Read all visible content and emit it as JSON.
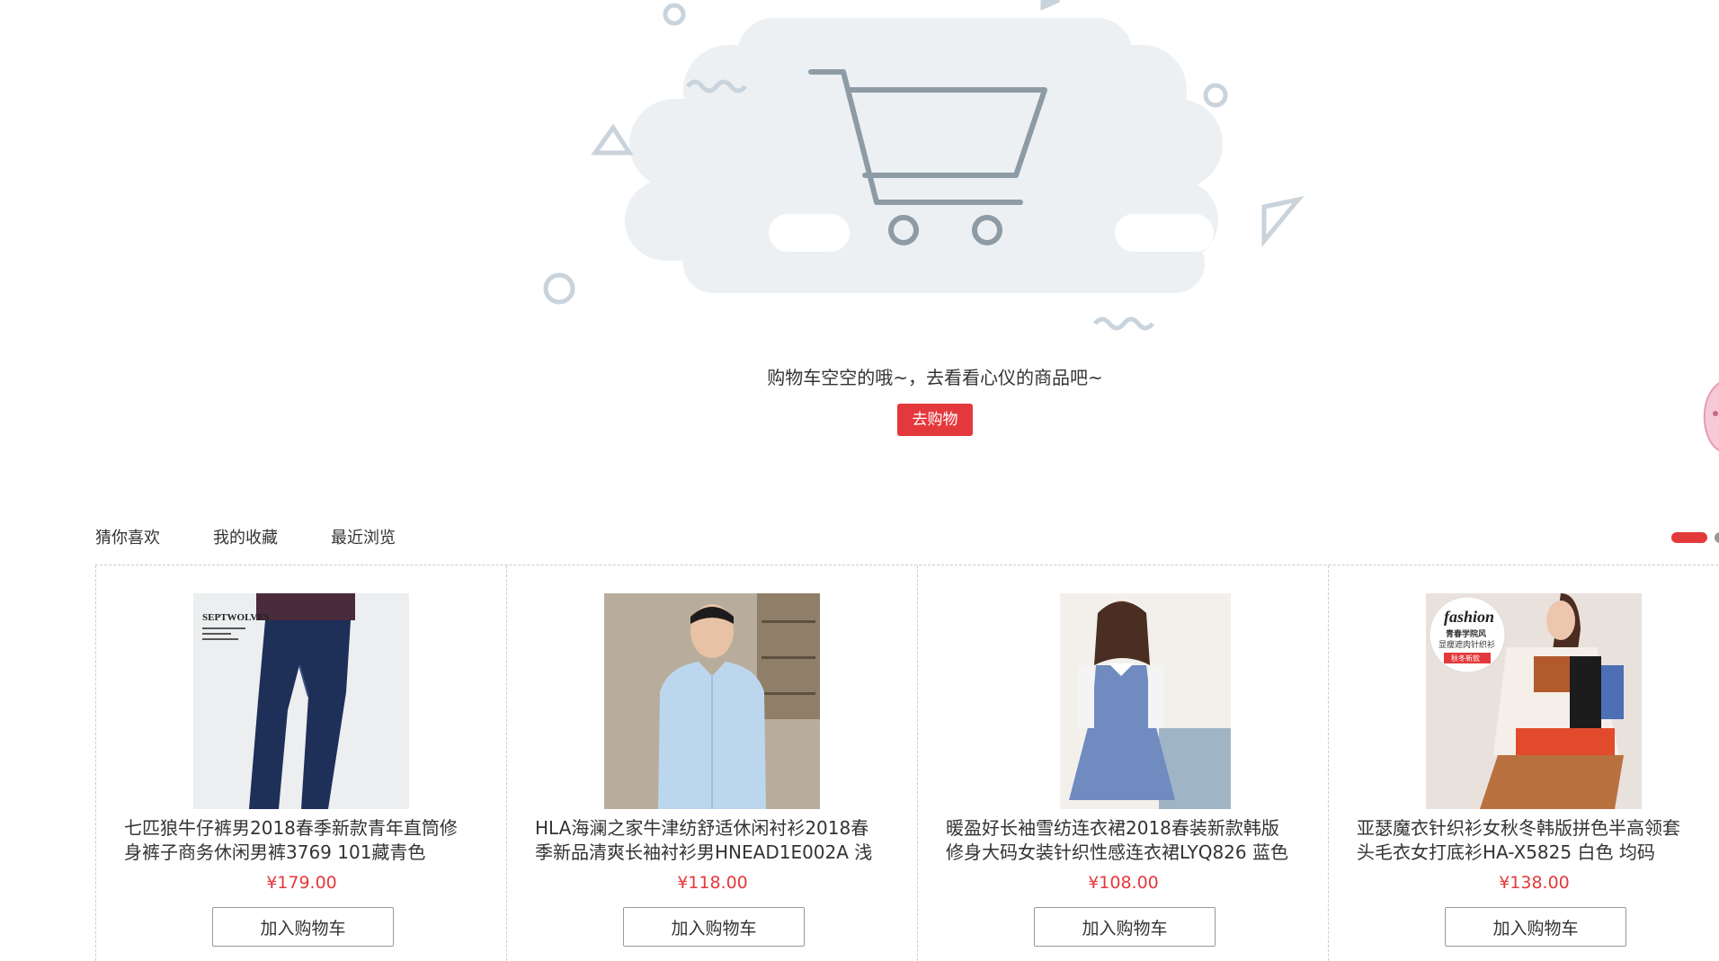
{
  "empty_cart": {
    "message": "购物车空空的哦~，去看看心仪的商品吧~",
    "go_shopping_label": "去购物"
  },
  "tabs": [
    {
      "label": "猜你喜欢"
    },
    {
      "label": "我的收藏"
    },
    {
      "label": "最近浏览"
    }
  ],
  "colors": {
    "accent": "#e4393c",
    "illustration_gray": "#edf0f3",
    "illustration_line": "#8d9ba5"
  },
  "products": [
    {
      "title": "七匹狼牛仔裤男2018春季新款青年直筒修\n身裤子商务休闲男裤3769 101藏青色",
      "price": "¥179.00",
      "add_cart_label": "加入购物车",
      "image_text": "SEPTWOLVES"
    },
    {
      "title": "HLA海澜之家牛津纺舒适休闲衬衫2018春\n季新品清爽长袖衬衫男HNEAD1E002A 浅",
      "price": "¥118.00",
      "add_cart_label": "加入购物车"
    },
    {
      "title": "暖盈好长袖雪纺连衣裙2018春装新款韩版\n修身大码女装针织性感连衣裙LYQ826 蓝色",
      "price": "¥108.00",
      "add_cart_label": "加入购物车"
    },
    {
      "title": "亚瑟魔衣针织衫女秋冬韩版拼色半高领套\n头毛衣女打底衫HA-X5825 白色 均码",
      "price": "¥138.00",
      "add_cart_label": "加入购物车",
      "image_text": "fashion",
      "image_subtext_1": "青春学院风",
      "image_subtext_2": "显瘦遮肉针织衫",
      "image_subtext_3": "秋冬新款"
    }
  ]
}
